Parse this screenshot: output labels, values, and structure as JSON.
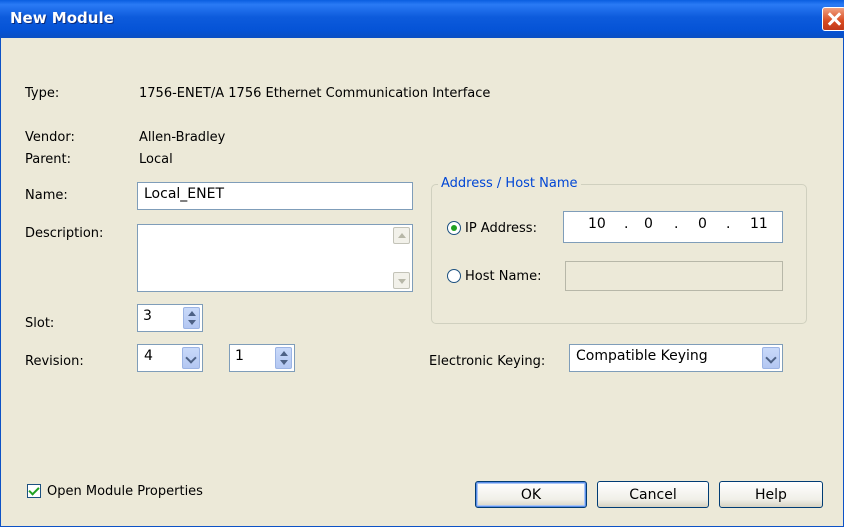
{
  "window": {
    "title": "New Module"
  },
  "fields": {
    "type_label": "Type:",
    "type_value": "1756-ENET/A 1756 Ethernet Communication Interface",
    "vendor_label": "Vendor:",
    "vendor_value": "Allen-Bradley",
    "parent_label": "Parent:",
    "parent_value": "Local",
    "name_label": "Name:",
    "name_value": "Local_ENET",
    "description_label": "Description:",
    "description_value": "",
    "slot_label": "Slot:",
    "slot_value": "3",
    "revision_label": "Revision:",
    "revision_major": "4",
    "revision_minor": "1"
  },
  "address_group": {
    "legend": "Address / Host Name",
    "ip_label": "IP Address:",
    "ip_octets": [
      "10",
      "0",
      "0",
      "11"
    ],
    "host_label": "Host Name:",
    "host_value": "",
    "selected": "ip"
  },
  "keying": {
    "label": "Electronic Keying:",
    "value": "Compatible Keying"
  },
  "footer": {
    "open_props_label": "Open Module Properties",
    "open_props_checked": true,
    "ok_label": "OK",
    "cancel_label": "Cancel",
    "help_label": "Help"
  },
  "colors": {
    "title_bar": "#0553d6",
    "dialog_bg": "#ece9d8",
    "group_legend": "#0046d5",
    "check_mark": "#21a121"
  }
}
